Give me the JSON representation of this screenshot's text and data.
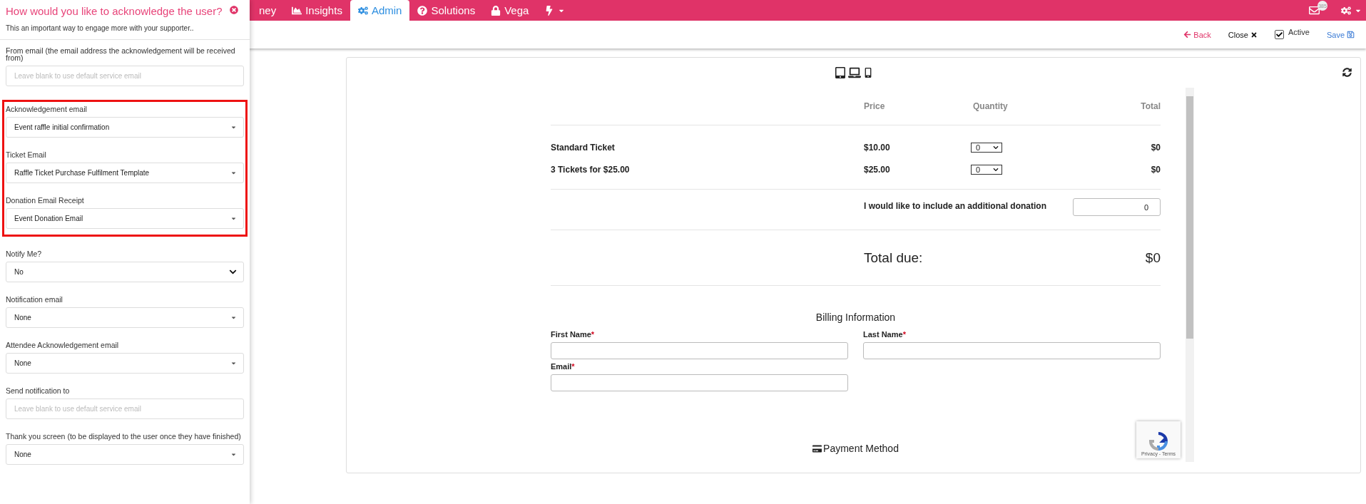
{
  "top_nav": {
    "items": [
      {
        "label": "ney",
        "selected": false
      },
      {
        "label": "Insights",
        "selected": false
      },
      {
        "label": "Admin",
        "selected": true
      },
      {
        "label": "Solutions",
        "selected": false
      },
      {
        "label": "Vega",
        "selected": false
      }
    ],
    "mail_badge": "385"
  },
  "toolbar": {
    "back": "Back",
    "close": "Close",
    "active": {
      "label": "Active",
      "checked": true
    },
    "save": "Save"
  },
  "panel": {
    "title": "How would you like to acknowledge the user?",
    "subtitle": "This an important way to engage more with your supporter..",
    "fields": [
      {
        "kind": "input",
        "label": "From email (the email address the acknowledgement will be received from)",
        "placeholder": "Leave blank to use default service email"
      },
      {
        "kind": "highlight",
        "fields": [
          {
            "kind": "select",
            "label": "Acknowledgement email",
            "value": "Event raffle initial confirmation"
          },
          {
            "kind": "select",
            "label": "Ticket Email",
            "value": "Raffle Ticket Purchase Fulfilment Template"
          },
          {
            "kind": "select",
            "label": "Donation Email Receipt",
            "value": "Event Donation Email"
          }
        ]
      },
      {
        "kind": "native",
        "label": "Notify Me?",
        "value": "No"
      },
      {
        "kind": "select",
        "label": "Notification email",
        "value": "None"
      },
      {
        "kind": "select",
        "label": "Attendee Acknowledgement email",
        "value": "None"
      },
      {
        "kind": "input",
        "label": "Send notification to",
        "placeholder": "Leave blank to use default service email"
      },
      {
        "kind": "select",
        "label": "Thank you screen (to be displayed to the user once they have finished)",
        "value": "None"
      }
    ]
  },
  "preview": {
    "columns": [
      "Price",
      "Quantity",
      "Total"
    ],
    "tickets": [
      {
        "name": "Standard Ticket",
        "price": "$10.00",
        "quantity": "0",
        "total": "$0"
      },
      {
        "name": "3 Tickets for $25.00",
        "price": "$25.00",
        "quantity": "0",
        "total": "$0"
      }
    ],
    "donation": {
      "label": "I would like to include an additional donation",
      "value": "0"
    },
    "total": {
      "label": "Total due:",
      "value": "$0"
    },
    "billing": {
      "title": "Billing Information",
      "fields": [
        {
          "label": "First Name",
          "required_mark": "*"
        },
        {
          "label": "Last Name",
          "required_mark": "*"
        },
        {
          "label": "Email",
          "required_mark": "*"
        }
      ]
    },
    "payment": "Payment Method",
    "recaptcha": "Privacy - Terms"
  }
}
